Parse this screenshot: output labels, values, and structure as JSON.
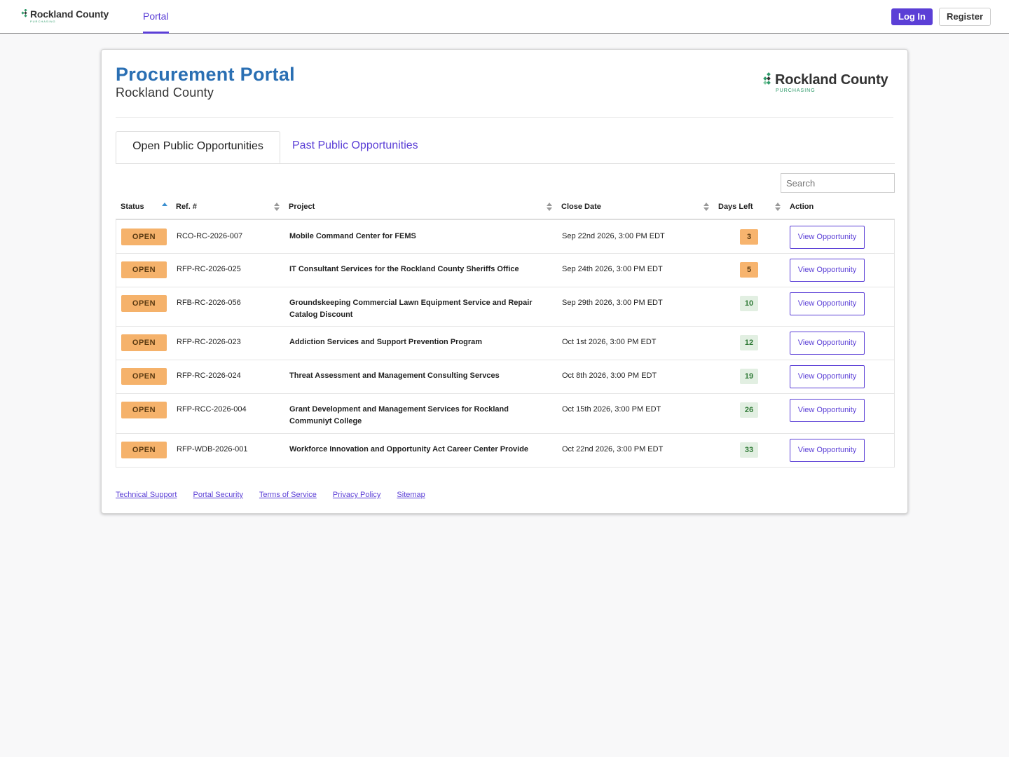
{
  "topnav": {
    "brand_name": "Rockland County",
    "brand_sub": "PURCHASING",
    "portal_link": "Portal",
    "login_label": "Log In",
    "register_label": "Register"
  },
  "header": {
    "title": "Procurement Portal",
    "subtitle": "Rockland County",
    "logo_name": "Rockland County",
    "logo_sub": "PURCHASING"
  },
  "tabs": {
    "open": "Open Public Opportunities",
    "past": "Past Public Opportunities"
  },
  "search": {
    "placeholder": "Search"
  },
  "table": {
    "columns": [
      "Status",
      "Ref. #",
      "Project",
      "Close Date",
      "Days Left",
      "Action"
    ],
    "rows": [
      {
        "status": "OPEN",
        "ref": "RCO-RC-2026-007",
        "project": "Mobile Command Center for FEMS",
        "close": "Sep 22nd 2026, 3:00 PM EDT",
        "days": "3",
        "action": "View Opportunity"
      },
      {
        "status": "OPEN",
        "ref": "RFP-RC-2026-025",
        "project": "IT Consultant Services for the Rockland County Sheriffs Office",
        "close": "Sep 24th 2026, 3:00 PM EDT",
        "days": "5",
        "action": "View Opportunity"
      },
      {
        "status": "OPEN",
        "ref": "RFB-RC-2026-056",
        "project": "Groundskeeping Commercial Lawn Equipment Service and Repair Catalog Discount",
        "close": "Sep 29th 2026, 3:00 PM EDT",
        "days": "10",
        "action": "View Opportunity"
      },
      {
        "status": "OPEN",
        "ref": "RFP-RC-2026-023",
        "project": "Addiction Services and Support Prevention Program",
        "close": "Oct 1st 2026, 3:00 PM EDT",
        "days": "12",
        "action": "View Opportunity"
      },
      {
        "status": "OPEN",
        "ref": "RFP-RC-2026-024",
        "project": "Threat Assessment and Management Consulting Servces",
        "close": "Oct 8th 2026, 3:00 PM EDT",
        "days": "19",
        "action": "View Opportunity"
      },
      {
        "status": "OPEN",
        "ref": "RFP-RCC-2026-004",
        "project": "Grant Development and Management Services for Rockland Communiyt College",
        "close": "Oct 15th 2026, 3:00 PM EDT",
        "days": "26",
        "action": "View Opportunity"
      },
      {
        "status": "OPEN",
        "ref": "RFP-WDB-2026-001",
        "project": "Workforce Innovation and Opportunity Act Career Center Provide",
        "close": "Oct 22nd 2026, 3:00 PM EDT",
        "days": "33",
        "action": "View Opportunity"
      }
    ]
  },
  "footer": {
    "links": [
      "Technical Support",
      "Portal Security",
      "Terms of Service",
      "Privacy Policy",
      "Sitemap"
    ]
  },
  "colors": {
    "accent": "#5b3fd6",
    "title_blue": "#2a6fb3",
    "open_badge": "#f5b26b",
    "days_warn": "#f7b46e",
    "days_ok": "#e2efe2",
    "logo_green": "#2e9b6a"
  },
  "icons": [
    "logo-diamond-icon",
    "sort-asc-icon",
    "sort-both-icon"
  ]
}
